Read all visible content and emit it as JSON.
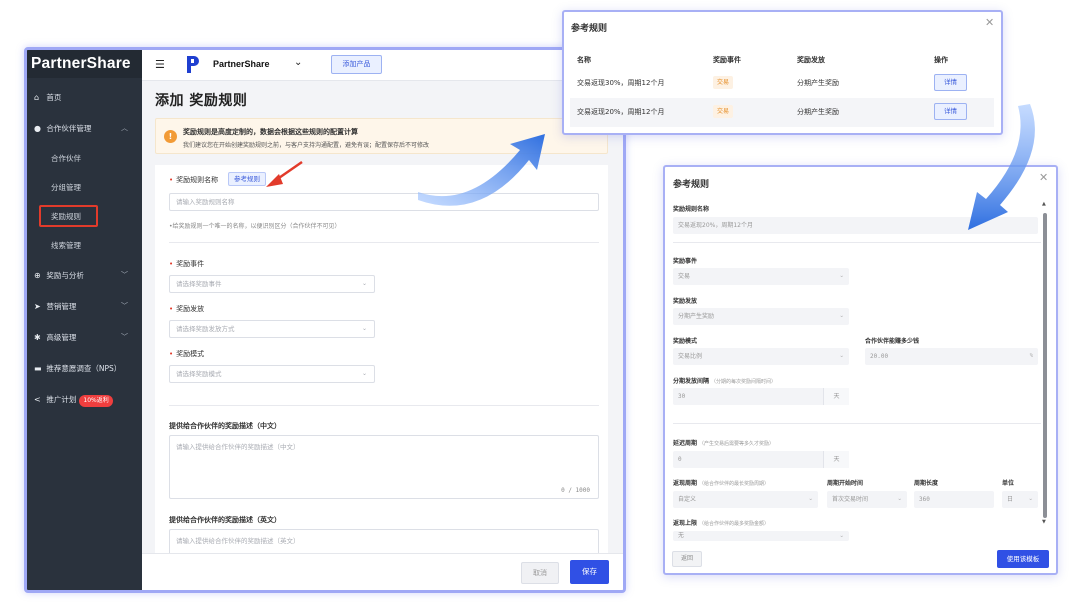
{
  "sidebar": {
    "logo": "PartnerShare",
    "items": [
      {
        "icon": "home-icon",
        "glyph": "⌂",
        "label": "首页"
      },
      {
        "icon": "user-icon",
        "glyph": "●",
        "label": "合作伙伴管理"
      },
      {
        "label": "合作伙伴"
      },
      {
        "label": "分组管理"
      },
      {
        "label": "奖励规则"
      },
      {
        "label": "线索管理"
      },
      {
        "icon": "plus-circle-icon",
        "glyph": "⊕",
        "label": "奖励与分析"
      },
      {
        "icon": "send-icon",
        "glyph": "➤",
        "label": "营销管理"
      },
      {
        "icon": "gear-icon",
        "glyph": "✱",
        "label": "高级管理"
      },
      {
        "icon": "chat-icon",
        "glyph": "▬",
        "label": "推荐意愿调查（NPS）"
      },
      {
        "icon": "share-icon",
        "glyph": "<",
        "label": "推广计划"
      }
    ],
    "promo_badge": "10%返利"
  },
  "topbar": {
    "brand": "PartnerShare",
    "add_product": "添加产品"
  },
  "main": {
    "title": "添加  奖励规则",
    "notice_title": "奖励规则是高度定制的，数据会根据这些规则的配置计算",
    "notice_text": "我们建议您在开始创建奖励规则之前，与客户支持沟通配置，避免有误；配置保存后不可修改",
    "rule_name_label": "奖励规则名称",
    "ref_rule_button": "参考规则",
    "rule_name_placeholder": "请输入奖励规则名称",
    "rule_name_hint": "•给奖励规则一个唯一的名称，以便识别区分（合作伙伴不可见）",
    "event_label": "奖励事件",
    "event_placeholder": "请选择奖励事件",
    "payout_label": "奖励发放",
    "payout_placeholder": "请选择奖励发放方式",
    "mode_label": "奖励模式",
    "mode_placeholder": "请选择奖励模式",
    "desc_cn_label": "提供给合作伙伴的奖励描述（中文）",
    "desc_cn_placeholder": "请输入提供给合作伙伴的奖励描述（中文）",
    "desc_cn_count": "0 / 1000",
    "desc_en_label": "提供给合作伙伴的奖励描述（英文）",
    "desc_en_placeholder": "请输入提供给合作伙伴的奖励描述（英文）",
    "cancel": "取消",
    "save": "保存"
  },
  "ref_list": {
    "title": "参考规则",
    "headers": [
      "名称",
      "奖励事件",
      "奖励发放",
      "操作"
    ],
    "rows": [
      {
        "name": "交易返现30%，周期12个月",
        "event": "交易",
        "payout": "分期产生奖励",
        "action": "详情"
      },
      {
        "name": "交易返现20%，周期12个月",
        "event": "交易",
        "payout": "分期产生奖励",
        "action": "详情"
      }
    ]
  },
  "ref_detail": {
    "title": "参考规则",
    "name_label": "奖励规则名称",
    "name_value": "交易返现20%，周期12个月",
    "event_label": "奖励事件",
    "event_value": "交易",
    "payout_label": "奖励发放",
    "payout_value": "分期产生奖励",
    "mode_label": "奖励模式",
    "mode_value": "交易比例",
    "percent_label": "合作伙伴能赚多少钱",
    "percent_value": "20.00",
    "percent_unit": "%",
    "interval_label": "分期发放间隔",
    "interval_hint": "（分期的每次奖励间隔时间）",
    "interval_value": "30",
    "interval_unit": "天",
    "delay_label": "延迟周期",
    "delay_hint": "（产生交易后需要等多久才奖励）",
    "delay_value": "0",
    "delay_unit": "天",
    "cycle_label": "返现周期",
    "cycle_hint": "（给合作伙伴的最长奖励周期）",
    "cycle_value": "自定义",
    "start_label": "周期开始时间",
    "start_value": "首次交易时间",
    "length_label": "周期长度",
    "length_value": "360",
    "unit_label": "单位",
    "unit_value": "日",
    "cap_label": "返现上限",
    "cap_hint": "（给合作伙伴的最多奖励金额）",
    "cap_value": "无",
    "back": "返回",
    "use": "使用该模板"
  },
  "colors": {
    "accent": "#3050e5",
    "sidebar_bg": "#2a323d",
    "annotation_red": "#e23b2b",
    "arrow_blue": "#3a78e8"
  }
}
